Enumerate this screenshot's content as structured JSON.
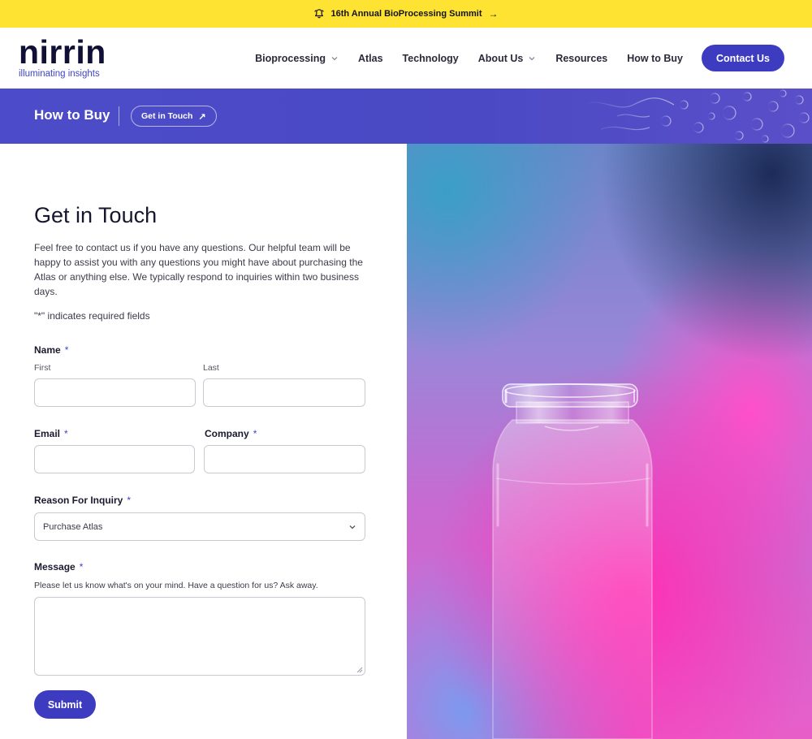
{
  "announcement": {
    "text": "16th Annual BioProcessing Summit",
    "arrow": "→"
  },
  "logo": {
    "wordmark": "nirrin",
    "tagline": "illuminating insights"
  },
  "nav": {
    "items": [
      {
        "label": "Bioprocessing",
        "has_dropdown": true
      },
      {
        "label": "Atlas",
        "has_dropdown": false
      },
      {
        "label": "Technology",
        "has_dropdown": false
      },
      {
        "label": "About Us",
        "has_dropdown": true
      },
      {
        "label": "Resources",
        "has_dropdown": false
      },
      {
        "label": "How to Buy",
        "has_dropdown": false
      }
    ],
    "cta": "Contact Us"
  },
  "banner": {
    "title": "How to Buy",
    "pill": "Get in Touch",
    "pill_icon": "↗"
  },
  "form": {
    "heading": "Get in Touch",
    "intro": "Feel free to contact us if you have any questions. Our helpful team will be happy to assist you with any questions you might have about purchasing the Atlas or anything else. We typically respond to inquiries within two business days.",
    "required_note": "\"*\" indicates required fields",
    "required_marker": "*",
    "name": {
      "label": "Name",
      "first_label": "First",
      "last_label": "Last",
      "first_value": "",
      "last_value": ""
    },
    "email": {
      "label": "Email",
      "value": ""
    },
    "company": {
      "label": "Company",
      "value": ""
    },
    "reason": {
      "label": "Reason For Inquiry",
      "selected": "Purchase Atlas"
    },
    "message": {
      "label": "Message",
      "hint": "Please let us know what's on your mind. Have a question for us? Ask away.",
      "value": ""
    },
    "submit_label": "Submit"
  },
  "colors": {
    "announce_bg": "#ffe333",
    "brand": "#3d3cc1",
    "banner_bg": "#4c4bc9",
    "logo_text": "#101036"
  }
}
